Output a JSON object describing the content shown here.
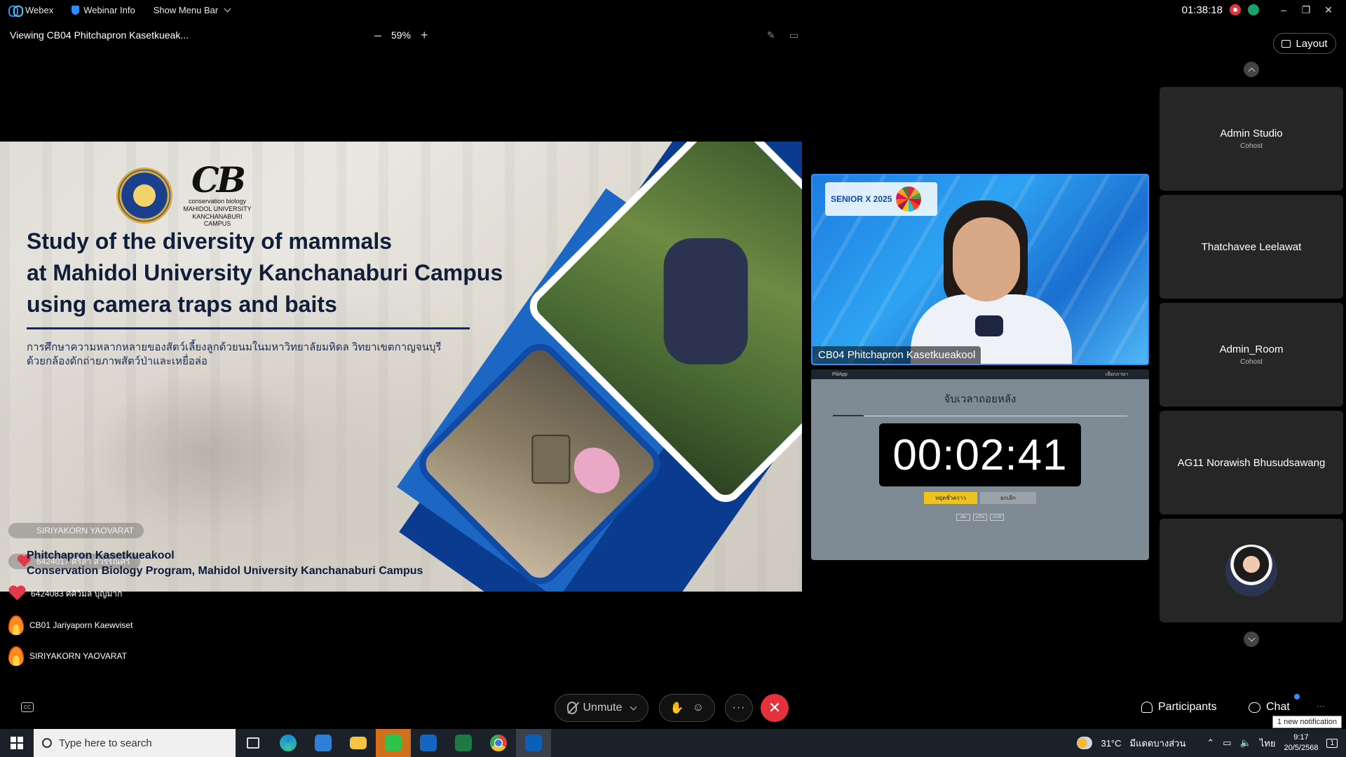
{
  "topbar": {
    "app_name": "Webex",
    "webinar_info": "Webinar Info",
    "show_menu_bar": "Show Menu Bar",
    "elapsed_time": "01:38:18",
    "window_controls": [
      "–",
      "❐",
      "✕"
    ]
  },
  "viewbar": {
    "viewing": "Viewing CB04 Phitchapron Kasetkueak...",
    "zoom_out": "–",
    "zoom_level": "59%",
    "zoom_in": "+",
    "layout_label": "Layout"
  },
  "slide": {
    "title_line1": "Study of the diversity of mammals",
    "title_line2": "at Mahidol University Kanchanaburi Campus",
    "title_line3": "using camera traps and baits",
    "thai_line1": "การศึกษาความหลากหลายของสัตว์เลี้ยงลูกด้วยนมในมหาวิทยาลัยมหิดล วิทยาเขตกาญจนบุรี",
    "thai_line2": "ด้วยกล้องดักถ่ายภาพสัตว์ป่าและเหยื่อล่อ",
    "logo_cb": "CB",
    "logo_sub1": "conservation biology",
    "logo_sub2": "MAHIDOL UNIVERSITY",
    "logo_sub3": "KANCHANABURI CAMPUS",
    "author": "Phitchapron Kasetkueakool",
    "program": "Conservation Biology Program, Mahidol University Kanchanaburi Campus",
    "overlay_reaction1": "SIRIYAKORN YAOVARAT",
    "overlay_reaction2": "6424017 ศิริสา สวรรณ์ศรี"
  },
  "reactions": [
    {
      "name": "6424083 ศศิวิมล บุญมาก",
      "icon": "heart-icon"
    },
    {
      "name": "CB01 Jariyaporn Kaewviset",
      "icon": "fire-icon"
    },
    {
      "name": "SIRIYAKORN YAOVARAT",
      "icon": "fire-icon"
    }
  ],
  "video": {
    "name": "CB04 Phitchapron Kasetkueakool",
    "banner": "SENIOR X 2025"
  },
  "timer": {
    "app_label": "PiliApp",
    "app_right": "เลือกภาษา",
    "title": "จับเวลาถอยหลัง",
    "time": "00:02:41",
    "pause_label": "หยุดชั่วคราว",
    "cancel_label": "ยกเลิก",
    "small_buttons": [
      "เพิ่ม",
      "แก้ไข",
      "+1:00"
    ]
  },
  "participants": [
    {
      "name": "Admin Studio",
      "role": "Cohost"
    },
    {
      "name": "Thatchavee Leelawat",
      "role": ""
    },
    {
      "name": "Admin_Room",
      "role": "Cohost"
    },
    {
      "name": "AG11 Norawish Bhusudsawang",
      "role": ""
    },
    {
      "name": "",
      "role": "",
      "avatar": true
    }
  ],
  "controls": {
    "unmute": "Unmute",
    "more": "···",
    "participants": "Participants",
    "chat": "Chat",
    "notification": "1 new notification"
  },
  "taskbar": {
    "search_placeholder": "Type here to search",
    "weather": "31°C",
    "weather_desc": "มีแดดบางส่วน",
    "language": "ไทย",
    "time": "9:17",
    "date": "20/5/2568",
    "notification_count": "1"
  },
  "colors": {
    "accent": "#3b8cf5",
    "leave_red": "#e4313c",
    "slide_navy": "#0b3b8f",
    "timer_yellow": "#f0c21d"
  }
}
